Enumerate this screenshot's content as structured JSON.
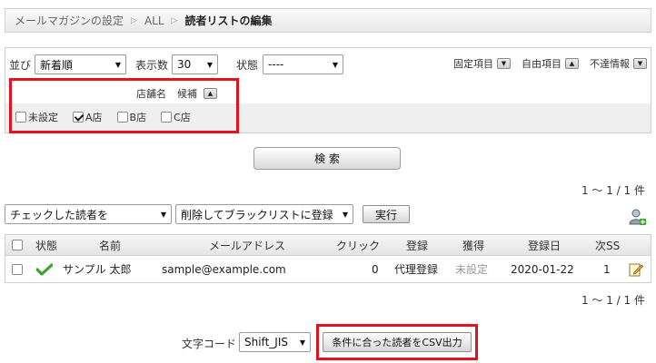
{
  "breadcrumb": {
    "items": [
      "メールマガジンの設定",
      "ALL",
      "読者リストの編集"
    ]
  },
  "filter": {
    "sort_label": "並び",
    "sort_value": "新着順",
    "page_size_label": "表示数",
    "page_size_value": "30",
    "status_label": "状態",
    "status_value": "----",
    "fixed_items_label": "固定項目",
    "free_items_label": "自由項目",
    "invalid_info_label": "不達情報",
    "shop_label": "店舗名",
    "candidate_label": "候補",
    "shops": [
      {
        "label": "未設定",
        "checked": false
      },
      {
        "label": "A店",
        "checked": true
      },
      {
        "label": "B店",
        "checked": false
      },
      {
        "label": "C店",
        "checked": false
      }
    ]
  },
  "search_button": "検 索",
  "count_text": "1 〜 1 / 1 件",
  "actions": {
    "target_value": "チェックした読者を",
    "operation_value": "削除してブラックリストに登録",
    "run_label": "実行"
  },
  "table": {
    "headers": [
      "状態",
      "名前",
      "メールアドレス",
      "クリック",
      "登録",
      "獲得",
      "登録日",
      "次SS"
    ],
    "rows": [
      {
        "name": "サンプル 太郎",
        "email": "sample@example.com",
        "click": "0",
        "registration": "代理登録",
        "acquisition": "未設定",
        "date": "2020-01-22",
        "next_ss": "1"
      }
    ]
  },
  "export": {
    "charset_label": "文字コード",
    "charset_value": "Shift_JIS",
    "csv_button": "条件に合った読者をCSV出力"
  },
  "colors": {
    "highlight": "#e3121d",
    "check_green": "#3aa52a"
  }
}
